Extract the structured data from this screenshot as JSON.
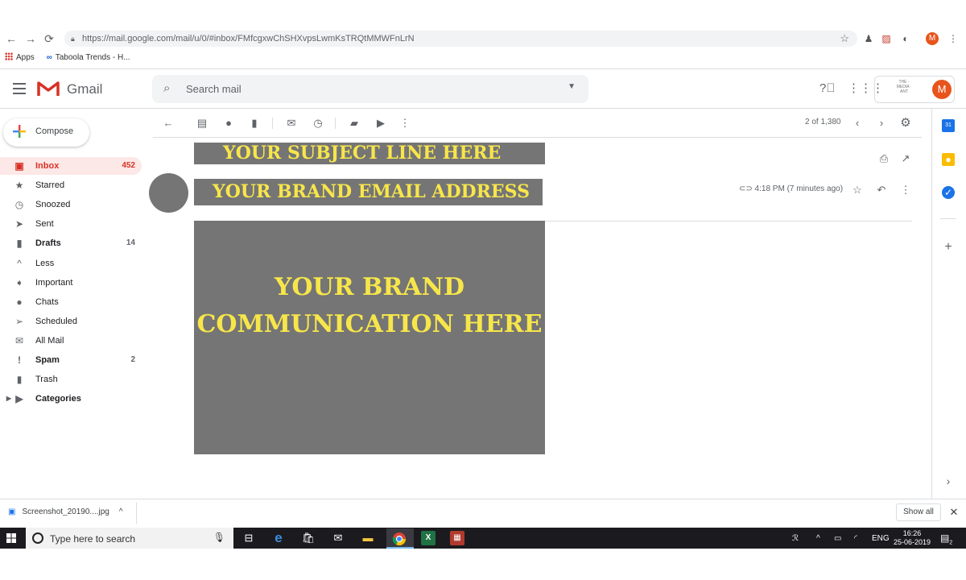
{
  "browser": {
    "url": "https://mail.google.com/mail/u/0/#inbox/FMfcgxwChSHXvpsLwmKsTRQtMMWFnLrN",
    "profile_initial": "M",
    "bookmarks": [
      "Apps",
      "Taboola Trends - H..."
    ]
  },
  "gmail": {
    "app_name": "Gmail",
    "search_placeholder": "Search mail",
    "avatar_initial": "M",
    "brand_mini": "THE · MEDIA · ANT",
    "compose_label": "Compose",
    "sidebar": [
      {
        "label": "Inbox",
        "count": "452",
        "icon": "inbox-icon"
      },
      {
        "label": "Starred",
        "count": "",
        "icon": "star-icon"
      },
      {
        "label": "Snoozed",
        "count": "",
        "icon": "clock-icon"
      },
      {
        "label": "Sent",
        "count": "",
        "icon": "send-icon"
      },
      {
        "label": "Drafts",
        "count": "14",
        "icon": "draft-icon"
      },
      {
        "label": "Less",
        "count": "",
        "icon": "chevron-up-icon"
      },
      {
        "label": "Important",
        "count": "",
        "icon": "important-icon"
      },
      {
        "label": "Chats",
        "count": "",
        "icon": "chat-icon"
      },
      {
        "label": "Scheduled",
        "count": "",
        "icon": "scheduled-icon"
      },
      {
        "label": "All Mail",
        "count": "",
        "icon": "mail-icon"
      },
      {
        "label": "Spam",
        "count": "2",
        "icon": "spam-icon"
      },
      {
        "label": "Trash",
        "count": "",
        "icon": "trash-icon"
      },
      {
        "label": "Categories",
        "count": "",
        "icon": "label-icon"
      }
    ],
    "pager": "2 of 1,380",
    "message": {
      "subject": "YOUR SUBJECT LINE HERE",
      "sender": "YOUR BRAND EMAIL ADDRESS",
      "time": "4:18 PM (7 minutes ago)",
      "body_line1": "YOUR BRAND",
      "body_line2": "COMMUNICATION HERE"
    }
  },
  "downloads": {
    "file": "Screenshot_20190....jpg",
    "show_all": "Show all"
  },
  "taskbar": {
    "search_placeholder": "Type here to search",
    "lang": "ENG",
    "time": "16:26",
    "date": "25-06-2019",
    "notif_count": "2"
  },
  "colors": {
    "gmail_red": "#d93025",
    "placeholder_gray": "#757575",
    "placeholder_text": "#f7e64a"
  }
}
